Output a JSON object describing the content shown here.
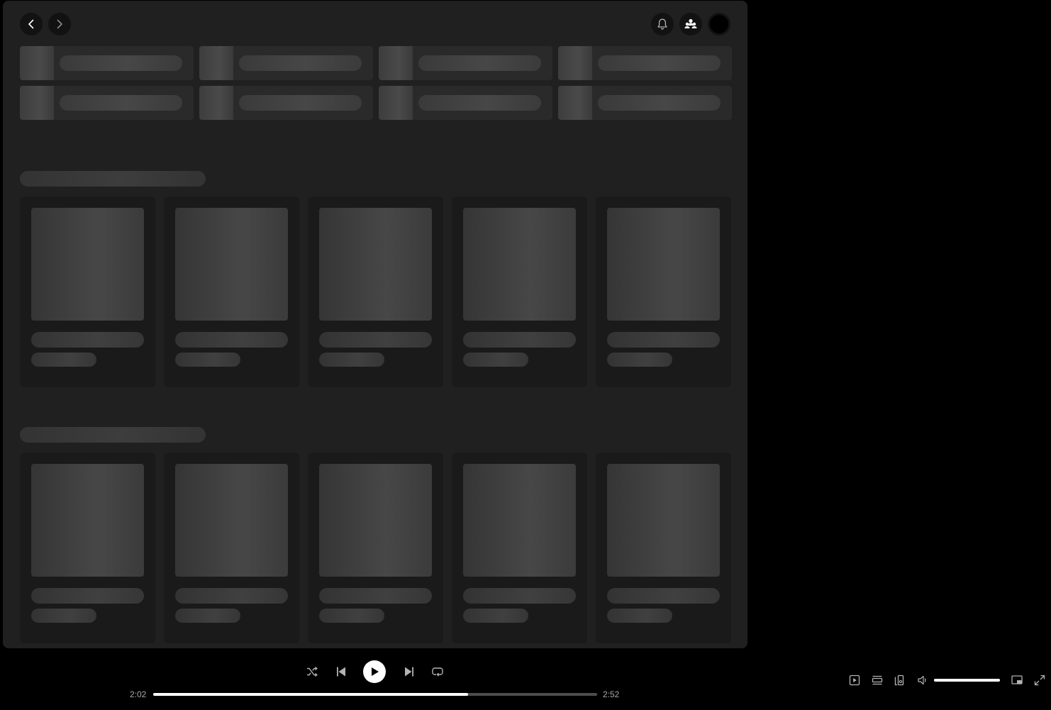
{
  "header": {
    "icons": {
      "back": "chevron-left-icon",
      "forward": "chevron-right-icon",
      "notifications": "bell-icon",
      "friends": "friends-icon",
      "profile": "avatar"
    }
  },
  "player": {
    "time_elapsed": "2:02",
    "time_total": "2:52",
    "progress": 0.71,
    "volume": 1.0,
    "colors": {
      "progress_fill": "#ffffff",
      "track": "#4d4d4d",
      "play_button": "#ffffff"
    }
  },
  "colors": {
    "background": "#000000",
    "panel": "#202020",
    "card": "#1a1a1a",
    "skeleton": "#3d3d3d"
  }
}
